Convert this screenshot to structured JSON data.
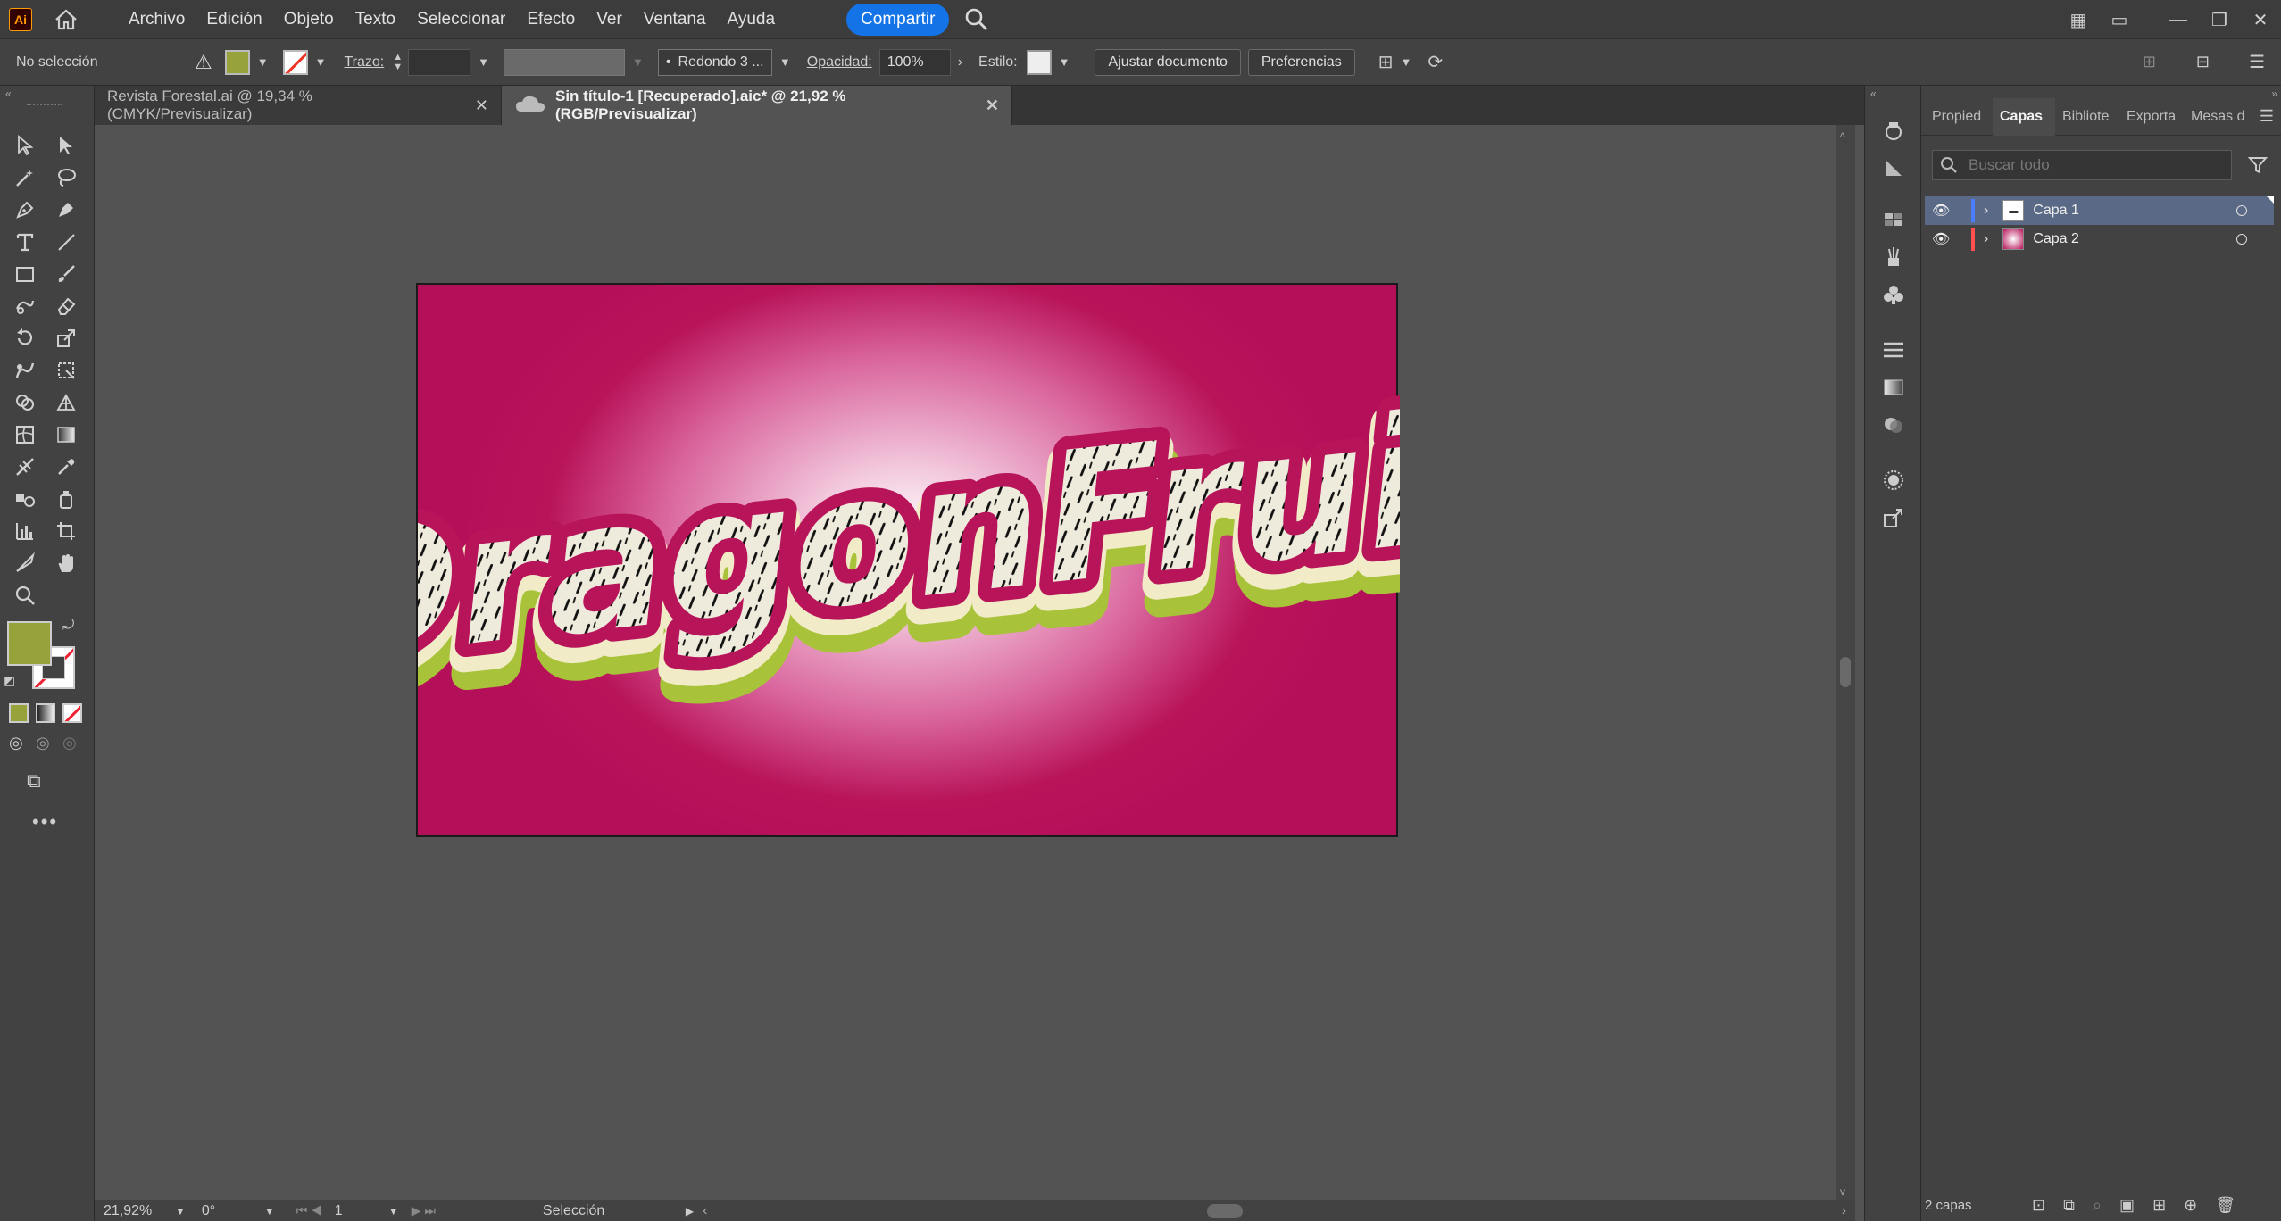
{
  "menubar": {
    "app_logo": "Ai",
    "items": [
      "Archivo",
      "Edición",
      "Objeto",
      "Texto",
      "Seleccionar",
      "Efecto",
      "Ver",
      "Ventana",
      "Ayuda"
    ],
    "share_label": "Compartir",
    "window_icons": [
      "arrange-documents-icon",
      "workspace-icon",
      "minimize-icon",
      "restore-icon",
      "close-icon"
    ]
  },
  "controlbar": {
    "selection_label": "No selección",
    "stroke_label": "Trazo:",
    "brush_label": "Redondo 3 ...",
    "opacity_label": "Opacidad:",
    "opacity_value": "100%",
    "style_label": "Estilo:",
    "fit_doc_button": "Ajustar documento",
    "prefs_button": "Preferencias",
    "fill_color": "#97a33a"
  },
  "tabs": [
    {
      "label": "Revista Forestal.ai @ 19,34 % (CMYK/Previsualizar)",
      "active": false
    },
    {
      "label": "Sin título-1 [Recuperado].aic* @ 21,92 % (RGB/Previsualizar)",
      "active": true
    }
  ],
  "artwork": {
    "text": "DragonFruit",
    "bg_colors": {
      "center": "#ffffff",
      "edge": "#b4105a"
    },
    "fill_color": "#eeeadc",
    "outline_color": "#b8145a",
    "shadow_color": "#a8c23a"
  },
  "statusbar": {
    "zoom": "21,92%",
    "rotation": "0°",
    "artboard_num": "1",
    "tool_name": "Selección"
  },
  "panel": {
    "tabs": [
      "Propied",
      "Capas",
      "Bibliote",
      "Exporta",
      "Mesas d"
    ],
    "active_tab": "Capas",
    "search_placeholder": "Buscar todo",
    "layers": [
      {
        "name": "Capa 1",
        "color": "#4a7dff",
        "selected": true
      },
      {
        "name": "Capa 2",
        "color": "#ff4f4f",
        "selected": false
      }
    ],
    "footer_count": "2 capas"
  }
}
